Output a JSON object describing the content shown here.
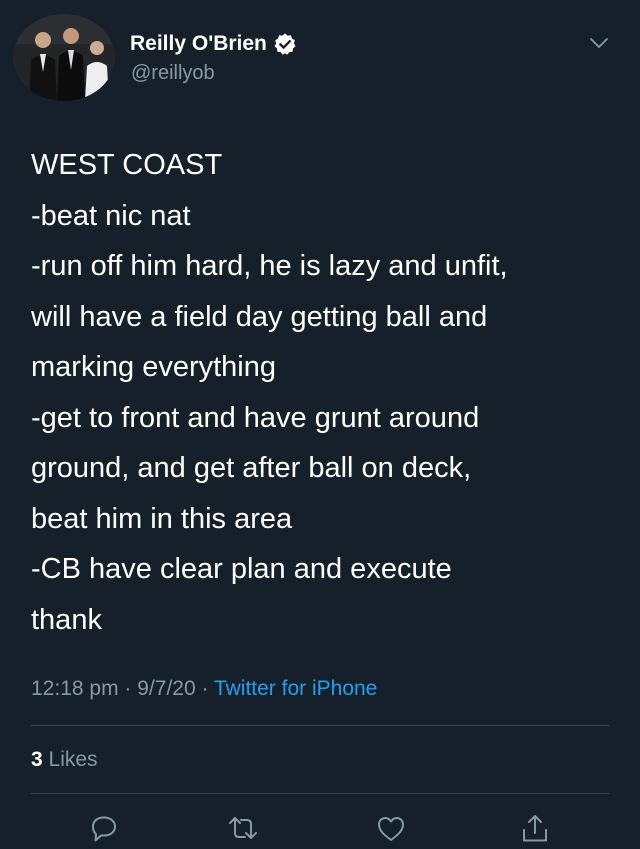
{
  "tweet": {
    "author": {
      "name": "Reilly O'Brien",
      "handle": "@reillyob",
      "verified": true
    },
    "lines": [
      "WEST COAST",
      "-beat nic nat",
      "-run off him hard, he is lazy and unfit,",
      "will have a field day getting ball and",
      "marking everything",
      "-get to front and have grunt around",
      "ground, and get after ball on deck,",
      "beat him in this area",
      "-CB have clear plan and execute",
      "thank"
    ],
    "time": "12:18 pm",
    "separator": "·",
    "date": "9/7/20",
    "source": "Twitter for iPhone",
    "likes": {
      "count": "3",
      "label": "Likes"
    }
  },
  "actions": {
    "icons": [
      "reply-icon",
      "retweet-icon",
      "like-icon",
      "share-icon"
    ]
  },
  "colors": {
    "background": "#15202b",
    "text_primary": "#ffffff",
    "text_secondary": "#8899a6",
    "accent": "#1da1f2",
    "divider": "#38444d"
  }
}
